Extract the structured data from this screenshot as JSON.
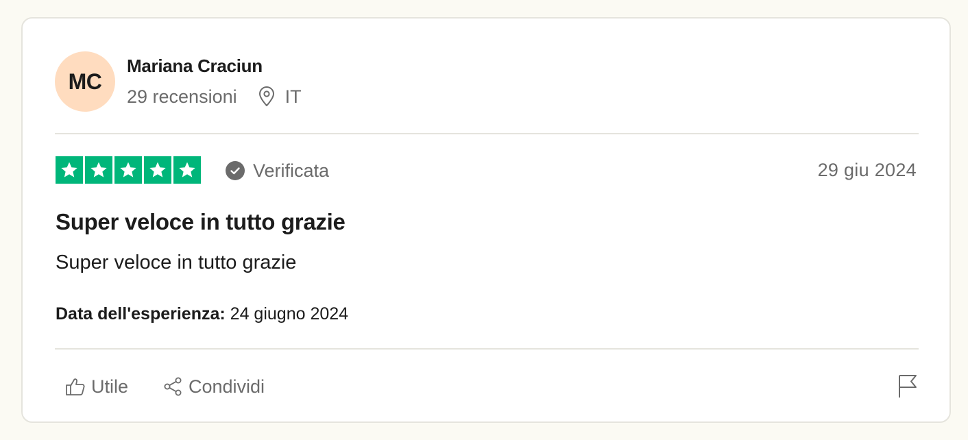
{
  "reviewer": {
    "initials": "MC",
    "name": "Mariana Craciun",
    "reviews_count": "29 recensioni",
    "country": "IT"
  },
  "review": {
    "rating": 5,
    "verified_label": "Verificata",
    "date": "29 giu 2024",
    "title": "Super veloce in tutto grazie",
    "body": "Super veloce in tutto grazie",
    "experience_label": "Data dell'esperienza:",
    "experience_date": "24 giugno 2024"
  },
  "actions": {
    "useful_label": "Utile",
    "share_label": "Condividi"
  },
  "icons": {
    "location": "location-pin-icon",
    "verified": "check-circle-icon",
    "useful": "thumbs-up-icon",
    "share": "share-icon",
    "report": "flag-icon"
  },
  "colors": {
    "star_background": "#00b67a",
    "avatar_background": "#ffdcbf",
    "muted_text": "#6b6b6b",
    "page_background": "#fbfaf3"
  }
}
